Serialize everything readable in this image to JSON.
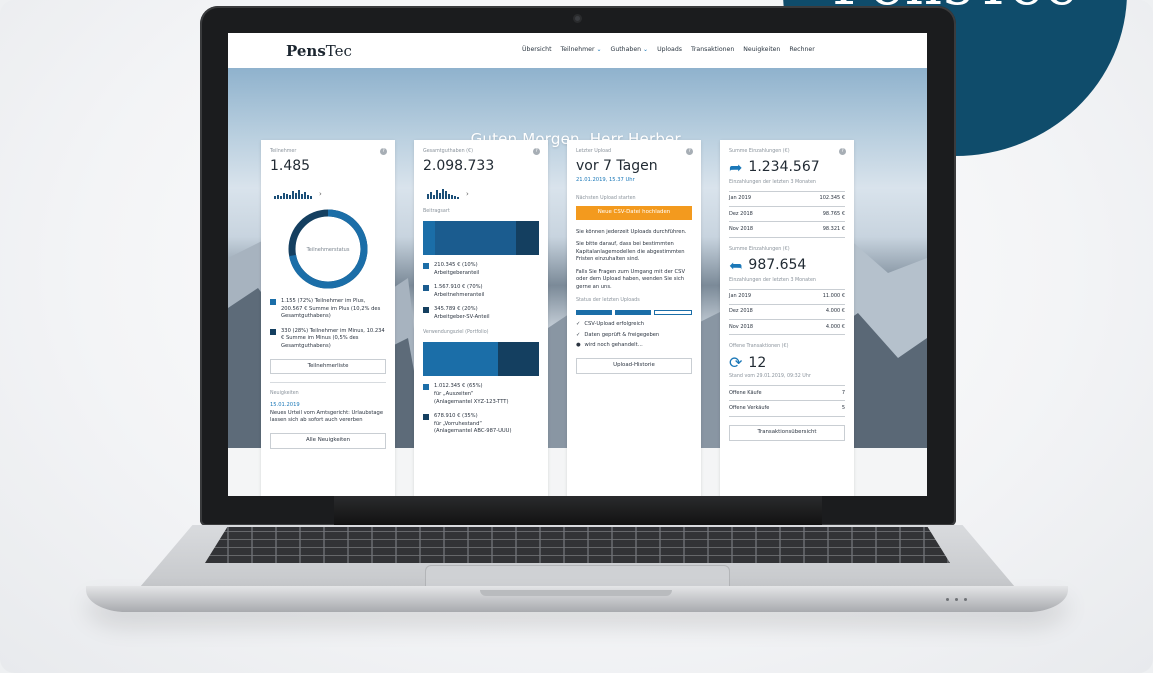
{
  "brand": {
    "circle_text": "PensTec",
    "logo_bold": "Pens",
    "logo_rest": "Tec"
  },
  "nav": {
    "items": [
      "Übersicht",
      "Teilnehmer",
      "Guthaben",
      "Uploads",
      "Transaktionen",
      "Neuigkeiten",
      "Rechner"
    ]
  },
  "greeting": "Guten Morgen, Herr Herber.",
  "colors": {
    "primary": "#1b6ea8",
    "dark": "#143f60",
    "accent": "#f39a1e",
    "brand": "#0f4c6b"
  },
  "teilnehmer": {
    "label": "Teilnehmer",
    "value": "1.485",
    "donut_label": "Teilnehmerstatus",
    "donut_plus_fraction": 0.72,
    "legend_plus": "1.155 (72%) Teilnehmer im Plus, 200.567 € Summe im Plus (10,2% des Gesamtguthabens)",
    "legend_minus": "330 (28%) Teilnehmer im Minus, 10.234 € Summe im Minus (0,5% des Gesamtguthabens)",
    "button": "Teilnehmerliste",
    "news_label": "Neuigkeiten",
    "news_date": "15.01.2019",
    "news_text": "Neues Urteil vom Amtsgericht: Urlaubstage lassen sich ab sofort auch vererben",
    "news_button": "Alle Neuigkeiten"
  },
  "guthaben": {
    "label": "Gesamtguthaben (€)",
    "value": "2.098.733",
    "beitragsart_label": "Beitragsart",
    "beitrag_shares": [
      0.1,
      0.7,
      0.2
    ],
    "beitrag_items": [
      {
        "amount": "210.345 € (10%)",
        "name": "Arbeitgeberanteil"
      },
      {
        "amount": "1.567.910 € (70%)",
        "name": "Arbeitnehmeranteil"
      },
      {
        "amount": "345.789 € (20%)",
        "name": "Arbeitgeber-SV-Anteil"
      }
    ],
    "verwendung_label": "Verwendungsziel (Portfolio)",
    "verwendung_shares": [
      0.65,
      0.35
    ],
    "verwendung_items": [
      {
        "amount": "1.012.345 € (65%)",
        "name": "für „Auszeiten“",
        "sub": "(Anlagemantel XYZ-123-TTT)"
      },
      {
        "amount": "678.910 € (35%)",
        "name": "für „Vorruhestand“",
        "sub": "(Anlagemantel ABC-987-UUU)"
      }
    ]
  },
  "upload": {
    "label": "Letzter Upload",
    "value": "vor 7 Tagen",
    "date": "21.01.2019, 15.37 Uhr",
    "next_label": "Nächsten Upload starten",
    "button_orange": "Neue CSV-Datei hochladen",
    "text1": "Sie können jederzeit Uploads durchführen.",
    "text2": "Sie bitte darauf, dass bei bestimmten Kapitalanlagemodellen die abgestimmten Fristen einzuhalten sind.",
    "text3": "Falls Sie Fragen zum Umgang mit der CSV oder dem Upload haben, wenden Sie sich gerne an uns.",
    "status_label": "Status der letzten Uploads",
    "steps_done": 2,
    "steps_total": 3,
    "step1": "CSV-Upload erfolgreich",
    "step2": "Daten geprüft & freigegeben",
    "step3": "wird noch gehandelt…",
    "button": "Upload-Historie"
  },
  "einzahlungen": {
    "label": "Summe Einzahlungen (€)",
    "value": "1.234.567",
    "sub_label": "Einzahlungen der letzten 3 Monaten",
    "rows": [
      {
        "month": "Jan 2019",
        "amount": "102.345 €"
      },
      {
        "month": "Dez 2018",
        "amount": "98.765 €"
      },
      {
        "month": "Nov 2018",
        "amount": "98.321 €"
      }
    ],
    "label2": "Summe Einzahlungen (€)",
    "value2": "987.654",
    "sub_label2": "Einzahlungen der letzten 3 Monaten",
    "rows2": [
      {
        "month": "Jan 2019",
        "amount": "11.000 €"
      },
      {
        "month": "Dez 2018",
        "amount": "4.000 €"
      },
      {
        "month": "Nov 2018",
        "amount": "4.000 €"
      }
    ],
    "open_label": "Offene Transaktionen (€)",
    "open_value": "12",
    "stand": "Stand vom 29.01.2019, 09:32 Uhr",
    "open_rows": [
      {
        "name": "Offene Käufe",
        "count": "7"
      },
      {
        "name": "Offene Verkäufe",
        "count": "5"
      }
    ],
    "button": "Transaktionsübersicht"
  }
}
